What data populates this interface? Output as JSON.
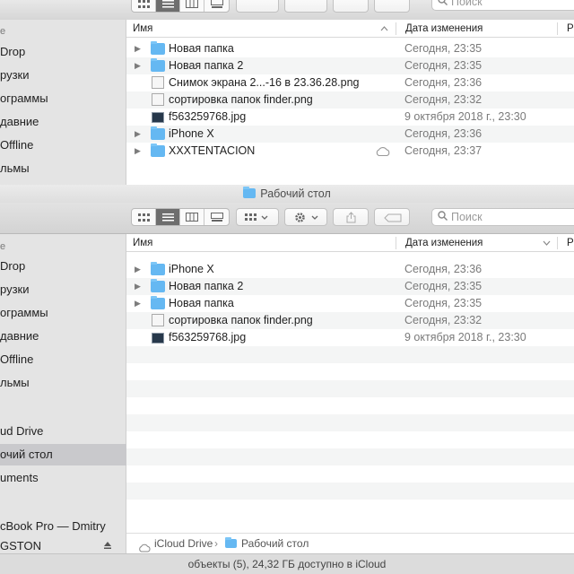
{
  "colors": {
    "folder": "#65b8f2",
    "selection": "#c9c9cc",
    "sidebar": "#e4e4e4"
  },
  "win1": {
    "search_placeholder": "Поиск",
    "sidebar": [
      "e",
      "Drop",
      "рузки",
      "ограммы",
      "давние",
      "Offline",
      "льмы"
    ],
    "columns": {
      "name": "Имя",
      "date": "Дата изменения",
      "extra": "Р"
    },
    "rows": [
      {
        "icon": "folder-icon",
        "name": "Новая папка",
        "date": "Сегодня, 23:35",
        "expand": true
      },
      {
        "icon": "folder-icon",
        "name": "Новая папка 2",
        "date": "Сегодня, 23:35",
        "expand": true
      },
      {
        "icon": "png-file-icon",
        "name": "Снимок экрана 2...-16 в 23.36.28.png",
        "date": "Сегодня, 23:36",
        "expand": false
      },
      {
        "icon": "png-file-icon",
        "name": "сортировка папок finder.png",
        "date": "Сегодня, 23:32",
        "expand": false
      },
      {
        "icon": "jpg-file-icon",
        "name": "f563259768.jpg",
        "date": "9 октября 2018 г., 23:30",
        "expand": false
      },
      {
        "icon": "folder-icon",
        "name": "iPhone X",
        "date": "Сегодня, 23:36",
        "expand": true
      },
      {
        "icon": "folder-icon",
        "name": "XXXTENTACION",
        "date": "Сегодня, 23:37",
        "expand": true
      }
    ]
  },
  "win2": {
    "title": "Рабочий стол",
    "search_placeholder": "Поиск",
    "sidebar": [
      "e",
      "Drop",
      "рузки",
      "ограммы",
      "давние",
      "Offline",
      "льмы",
      "ud Drive",
      "очий стол",
      "uments",
      "cBook Pro — Dmitry",
      "GSTON"
    ],
    "columns": {
      "name": "Имя",
      "date": "Дата изменения",
      "extra": "Р"
    },
    "rows": [
      {
        "icon": "folder-icon",
        "name": "iPhone X",
        "date": "Сегодня, 23:36",
        "expand": true
      },
      {
        "icon": "folder-icon",
        "name": "Новая папка 2",
        "date": "Сегодня, 23:35",
        "expand": true
      },
      {
        "icon": "folder-icon",
        "name": "Новая папка",
        "date": "Сегодня, 23:35",
        "expand": true
      },
      {
        "icon": "png-file-icon",
        "name": "сортировка папок finder.png",
        "date": "Сегодня, 23:32",
        "expand": false
      },
      {
        "icon": "jpg-file-icon",
        "name": "f563259768.jpg",
        "date": "9 октября 2018 г., 23:30",
        "expand": false
      }
    ],
    "path": {
      "root": "iCloud Drive",
      "sep": "›",
      "folder": "Рабочий стол"
    },
    "status": "объекты (5), 24,32 ГБ доступно в iCloud"
  }
}
